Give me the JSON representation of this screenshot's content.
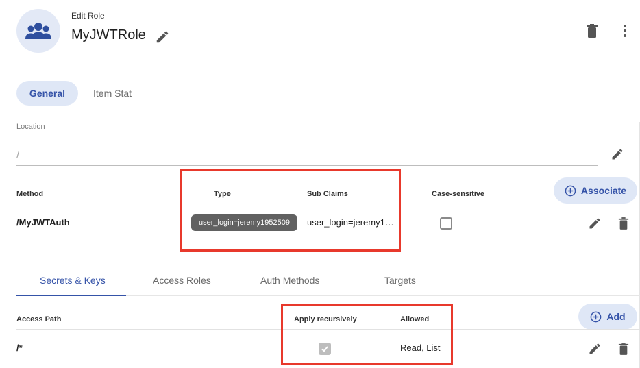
{
  "header": {
    "subtitle": "Edit Role",
    "title": "MyJWTRole"
  },
  "tabs": [
    "General",
    "Item Stat"
  ],
  "location": {
    "label": "Location",
    "value": "/"
  },
  "auth_table": {
    "headers": {
      "method": "Method",
      "type": "Type",
      "sub_claims": "Sub Claims",
      "case_sensitive": "Case-sensitive"
    },
    "associate_label": "Associate",
    "rows": [
      {
        "method": "/MyJWTAuth",
        "type_chip": "user_login=jeremy1952509",
        "sub_claims": "user_login=jeremy1…",
        "case_sensitive": false
      }
    ]
  },
  "sub_tabs": [
    "Secrets & Keys",
    "Access Roles",
    "Auth Methods",
    "Targets"
  ],
  "active_sub_tab": "Secrets & Keys",
  "access_table": {
    "headers": {
      "access_path": "Access Path",
      "apply_recursively": "Apply recursively",
      "allowed": "Allowed"
    },
    "add_label": "Add",
    "rows": [
      {
        "path": "/*",
        "apply_recursively": true,
        "allowed": "Read, List"
      }
    ]
  },
  "colors": {
    "accent": "#3553a8",
    "accent_bg": "#dfe7f6",
    "highlight": "#e8392c",
    "chip_bg": "#616161"
  },
  "icons": [
    "users-group-icon",
    "pencil-icon",
    "trash-icon",
    "more-vert-icon",
    "plus-circle-icon",
    "check-icon"
  ]
}
